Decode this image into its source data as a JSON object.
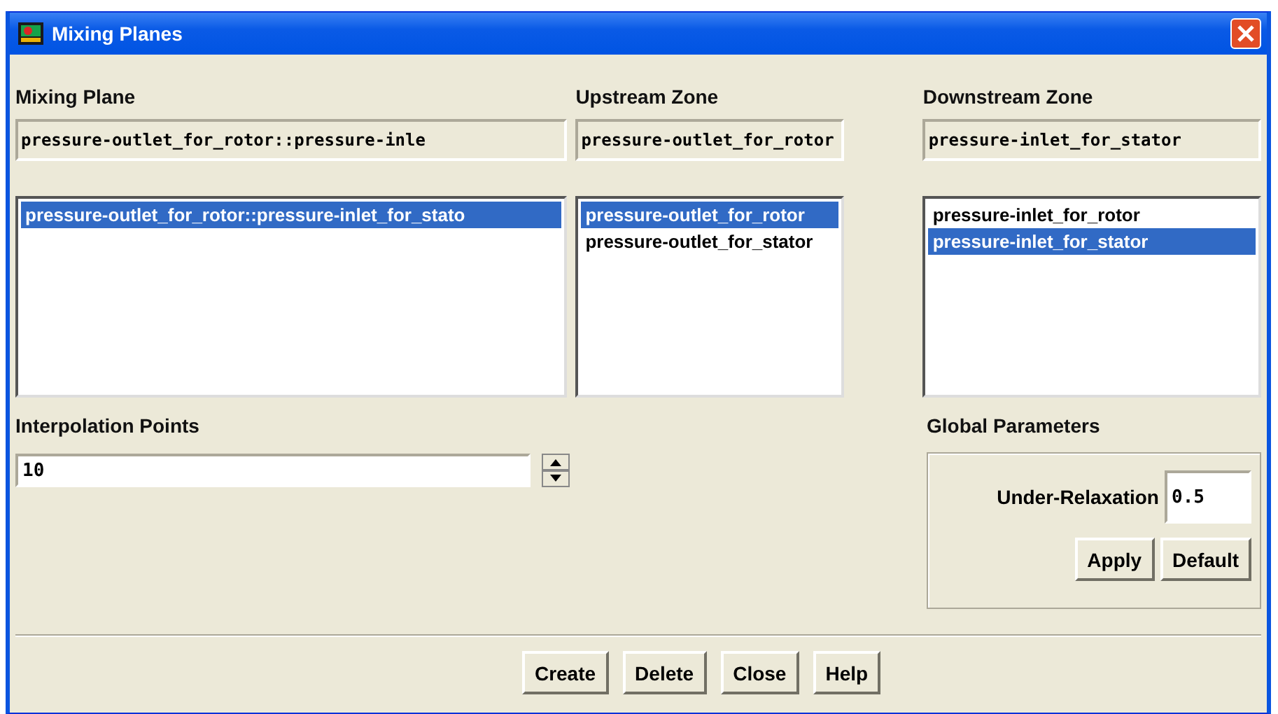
{
  "window": {
    "title": "Mixing Planes"
  },
  "mixing_plane": {
    "label": "Mixing Plane",
    "value": "pressure-outlet_for_rotor::pressure-inle",
    "items": [
      {
        "label": "pressure-outlet_for_rotor::pressure-inlet_for_stato",
        "selected": true
      }
    ]
  },
  "upstream_zone": {
    "label": "Upstream Zone",
    "value": "pressure-outlet_for_rotor",
    "items": [
      {
        "label": "pressure-outlet_for_rotor",
        "selected": true
      },
      {
        "label": "pressure-outlet_for_stator",
        "selected": false
      }
    ]
  },
  "downstream_zone": {
    "label": "Downstream Zone",
    "value": "pressure-inlet_for_stator",
    "items": [
      {
        "label": "pressure-inlet_for_rotor",
        "selected": false
      },
      {
        "label": "pressure-inlet_for_stator",
        "selected": true
      }
    ]
  },
  "interpolation_points": {
    "label": "Interpolation Points",
    "value": "10"
  },
  "global_parameters": {
    "label": "Global Parameters",
    "under_relaxation": {
      "label": "Under-Relaxation",
      "value": "0.5"
    },
    "buttons": [
      "Apply",
      "Default"
    ]
  },
  "buttons": [
    "Create",
    "Delete",
    "Close",
    "Help"
  ]
}
